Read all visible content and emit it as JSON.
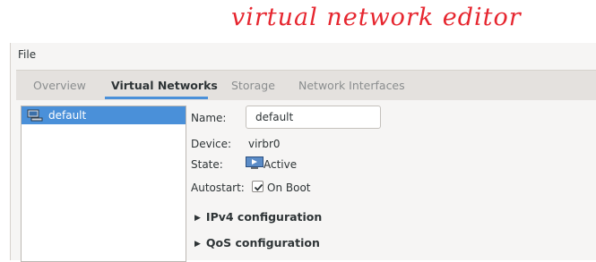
{
  "annotation": {
    "text": "virtual network editor",
    "color": "#e6262f"
  },
  "menubar": {
    "file": "File"
  },
  "tabs": [
    {
      "label": "Overview",
      "active": false
    },
    {
      "label": "Virtual Networks",
      "active": true
    },
    {
      "label": "Storage",
      "active": false
    },
    {
      "label": "Network Interfaces",
      "active": false
    }
  ],
  "networks": [
    {
      "label": "default",
      "selected": true
    }
  ],
  "details": {
    "name_label": "Name:",
    "name_value": "default",
    "device_label": "Device:",
    "device_value": "virbr0",
    "state_label": "State:",
    "state_value": "Active",
    "autostart_label": "Autostart:",
    "autostart_value": "On Boot",
    "autostart_checked": true,
    "ipv4_label": "IPv4 configuration",
    "qos_label": "QoS configuration"
  },
  "colors": {
    "accent": "#4a90d9",
    "window_bg": "#f6f5f4",
    "tab_bg": "#e4e1de"
  }
}
